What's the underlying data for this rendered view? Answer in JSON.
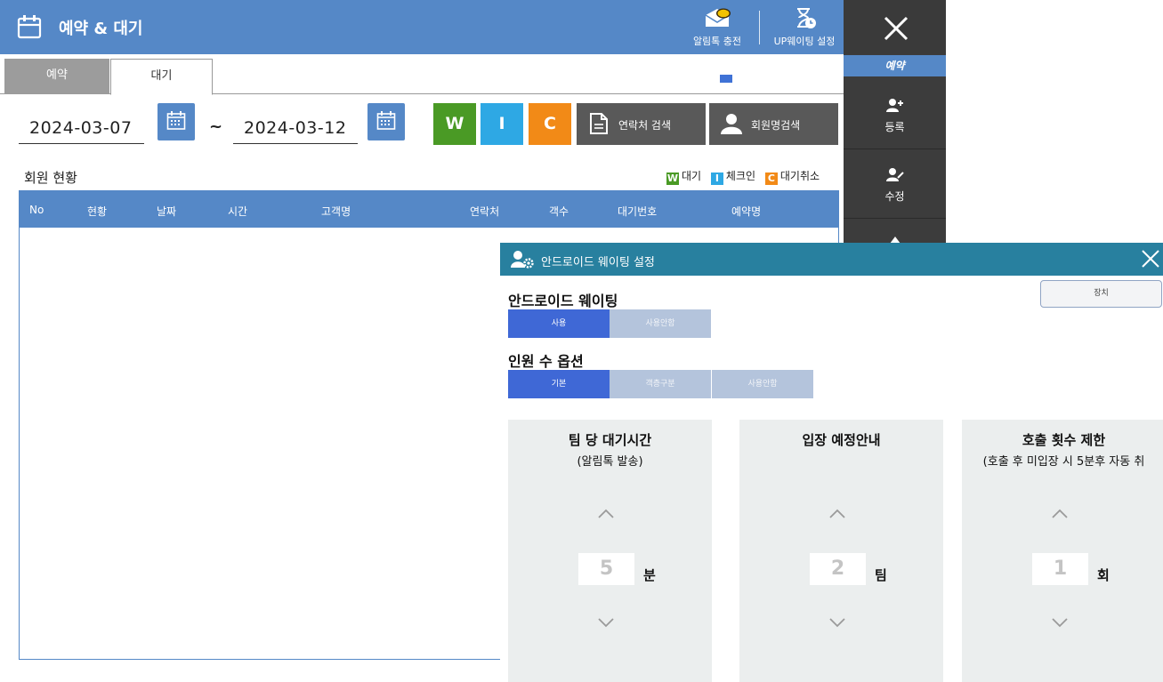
{
  "header": {
    "title": "예약 & 대기",
    "alimtalk_label": "알림톡 충전",
    "waiting_settings_label": "UP웨이팅 설정"
  },
  "sidebar": {
    "mode_label": "예약",
    "items": [
      {
        "label": "등록"
      },
      {
        "label": "수정"
      }
    ]
  },
  "tabs": [
    {
      "label": "예약",
      "active": false
    },
    {
      "label": "대기",
      "active": true
    }
  ],
  "filters": {
    "start_date": "2024-03-07",
    "separator": "~",
    "end_date": "2024-03-12",
    "status_buttons": [
      {
        "label": "W",
        "color": "#4a9a25"
      },
      {
        "label": "I",
        "color": "#2ea8e4"
      },
      {
        "label": "C",
        "color": "#f28a17"
      }
    ],
    "contact_search_label": "연락처 검색",
    "member_search_label": "회원명검색"
  },
  "member_status": {
    "title": "회원 현황",
    "legend": [
      {
        "key": "W",
        "label": "대기",
        "color": "#4a9a25"
      },
      {
        "key": "I",
        "label": "체크인",
        "color": "#2ea8e4"
      },
      {
        "key": "C",
        "label": "대기취소",
        "color": "#f28a17"
      }
    ],
    "columns": [
      "No",
      "현황",
      "날짜",
      "시간",
      "고객명",
      "연락처",
      "객수",
      "대기번호",
      "예약명"
    ],
    "rows": []
  },
  "modal": {
    "title": "안드로이드 웨이팅 설정",
    "device_button_label": "장치",
    "android_waiting": {
      "title": "안드로이드 웨이팅",
      "options": [
        "사용",
        "사용안함"
      ],
      "selected": "사용"
    },
    "headcount_option": {
      "title": "인원 수 옵션",
      "options": [
        "기본",
        "객층구분",
        "사용안함"
      ],
      "selected": "기본"
    },
    "panels": [
      {
        "title": "팀 당 대기시간",
        "subtitle": "(알림톡 발송)",
        "value": "5",
        "unit": "분"
      },
      {
        "title": "입장 예정안내",
        "subtitle": "",
        "value": "2",
        "unit": "팀"
      },
      {
        "title": "호출 횟수 제한",
        "subtitle": "(호출 후 미입장 시 5분후 자동 취",
        "value": "1",
        "unit": "회"
      }
    ]
  },
  "colors": {
    "header_blue": "#5588c7",
    "modal_header": "#28809f",
    "segment_on": "#3f68d6",
    "segment_off": "#b4c4dc"
  }
}
